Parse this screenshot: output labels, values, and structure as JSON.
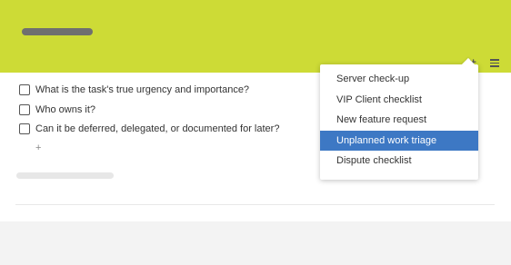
{
  "colors": {
    "header_bg": "#cddb36",
    "selected_bg": "#3d78c4",
    "page_bg": "#f3f3f3"
  },
  "icons": {
    "sort": "sort-icon",
    "menu": "hamburger-menu-icon"
  },
  "toolbar": {
    "sort_glyph": "≡+"
  },
  "checklist": {
    "items": [
      {
        "label": "What is the task's true urgency and importance?",
        "checked": false
      },
      {
        "label": "Who owns it?",
        "checked": false
      },
      {
        "label": "Can it be deferred, delegated, or documented for later?",
        "checked": false
      }
    ],
    "add_glyph": "+"
  },
  "dropdown": {
    "items": [
      {
        "label": "Server check-up",
        "selected": false
      },
      {
        "label": "VIP Client checklist",
        "selected": false
      },
      {
        "label": "New feature request",
        "selected": false
      },
      {
        "label": "Unplanned work triage",
        "selected": true
      },
      {
        "label": "Dispute checklist",
        "selected": false
      }
    ]
  }
}
